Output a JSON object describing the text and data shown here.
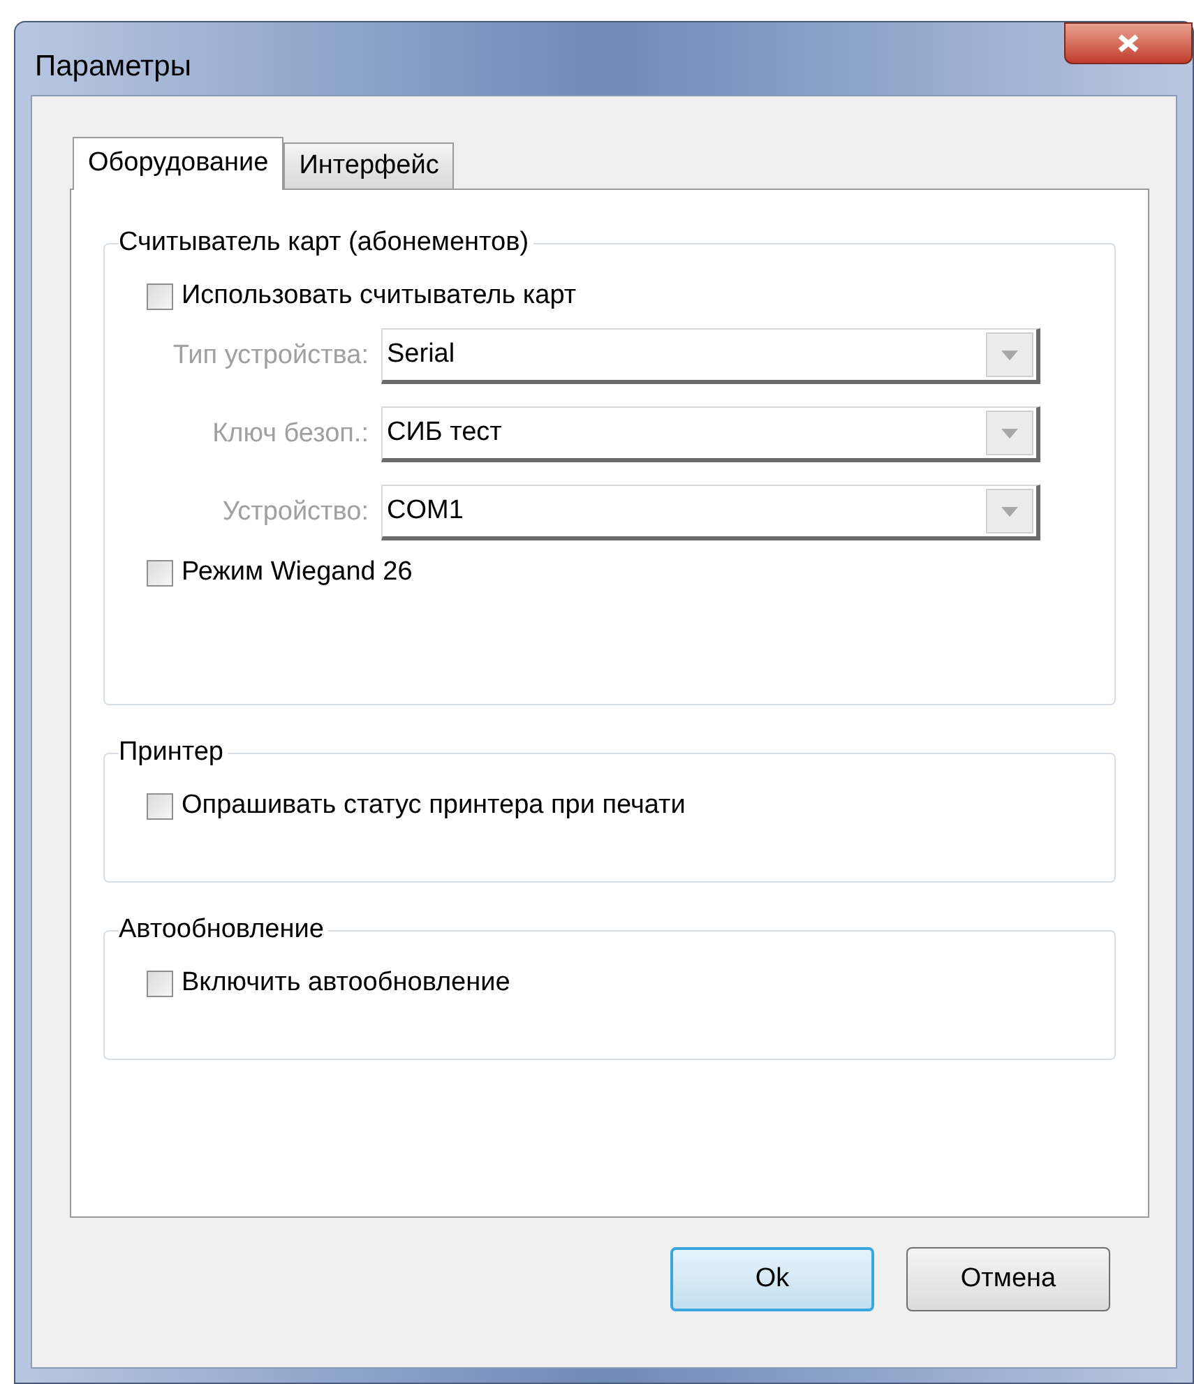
{
  "window": {
    "title": "Параметры"
  },
  "tabs": [
    {
      "label": "Оборудование",
      "selected": true
    },
    {
      "label": "Интерфейс",
      "selected": false
    }
  ],
  "groups": [
    {
      "title": "Считыватель карт (абонементов)",
      "items": [
        {
          "kind": "checkbox",
          "label": "Использовать считыватель карт",
          "checked": false
        },
        {
          "kind": "select",
          "label": "Тип устройства:",
          "value": "Serial",
          "disabled": true
        },
        {
          "kind": "select",
          "label": "Ключ безоп.:",
          "value": "СИБ тест",
          "disabled": true
        },
        {
          "kind": "select",
          "label": "Устройство:",
          "value": "COM1",
          "disabled": true
        },
        {
          "kind": "checkbox",
          "label": "Режим Wiegand 26",
          "checked": false
        }
      ]
    },
    {
      "title": "Принтер",
      "items": [
        {
          "kind": "checkbox",
          "label": "Опрашивать статус принтера при печати",
          "checked": false
        }
      ]
    },
    {
      "title": "Автообновление",
      "items": [
        {
          "kind": "checkbox",
          "label": "Включить автообновление",
          "checked": false
        }
      ]
    }
  ],
  "buttons": [
    {
      "label": "Ok",
      "default": true
    },
    {
      "label": "Отмена",
      "default": false
    }
  ]
}
